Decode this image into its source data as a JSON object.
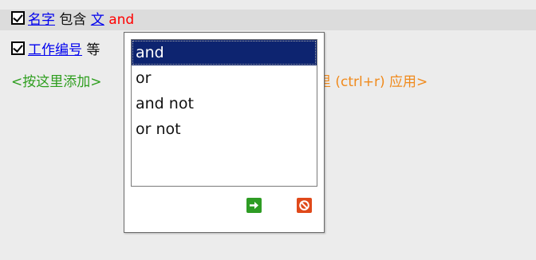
{
  "criteria": [
    {
      "checked": true,
      "field": "名字",
      "operator": "包含",
      "value": "文",
      "conjunction": "and"
    },
    {
      "checked": true,
      "field": "工作编号",
      "operator_partial": "等"
    }
  ],
  "add_hint": {
    "prefix": "<按这里添加>",
    "suffix": "里 (ctrl+r) 应用>"
  },
  "conjunction_picker": {
    "options": [
      "and",
      "or",
      "and not",
      "or not"
    ],
    "selected": "and",
    "ok_icon": "arrow-right-icon",
    "cancel_icon": "no-entry-icon"
  },
  "colors": {
    "link": "#0000ee",
    "conjunction": "#ff0000",
    "hint_green": "#2e9e1e",
    "hint_orange": "#f08a1c",
    "selected_bg": "#0d2470",
    "ok_button": "#2e9c24",
    "cancel_button": "#e0491a"
  }
}
